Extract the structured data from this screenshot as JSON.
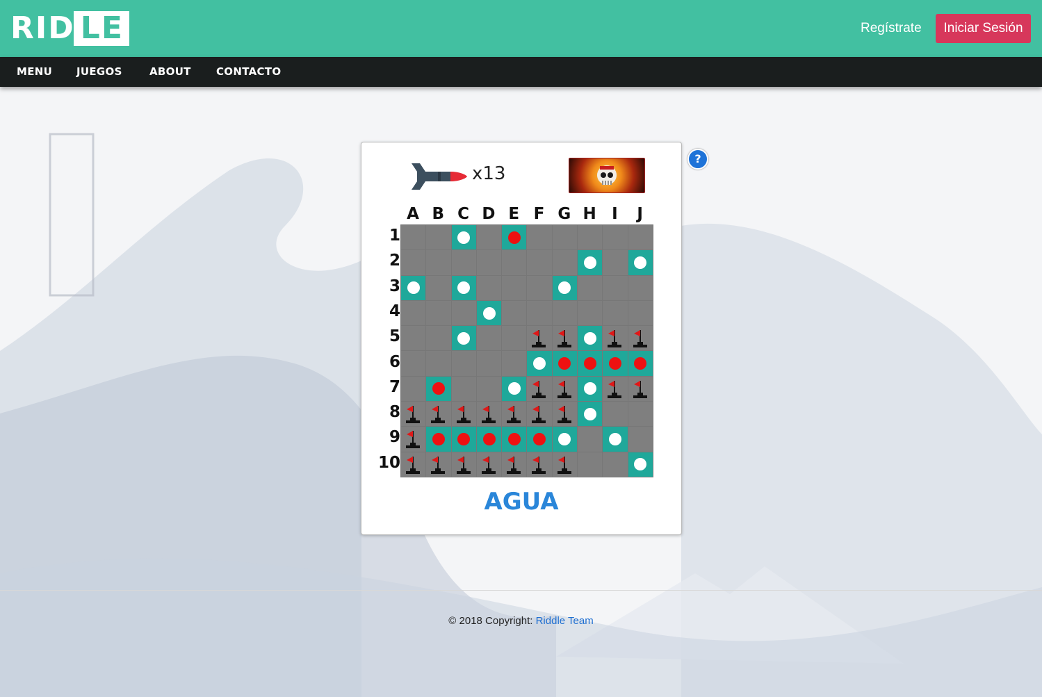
{
  "brand": {
    "logo_text": "RID",
    "logo_boxed_text": "LE"
  },
  "header": {
    "register_label": "Regístrate",
    "login_label": "Iniciar Sesión"
  },
  "nav": {
    "items": [
      "MENU",
      "JUEGOS",
      "ABOUT",
      "CONTACTO"
    ]
  },
  "game": {
    "ammo_label": "x13",
    "ammo_icon": "missile-icon",
    "enemy_icon": "skull-pilot-icon",
    "columns": [
      "A",
      "B",
      "C",
      "D",
      "E",
      "F",
      "G",
      "H",
      "I",
      "J"
    ],
    "rows": [
      "1",
      "2",
      "3",
      "4",
      "5",
      "6",
      "7",
      "8",
      "9",
      "10"
    ],
    "legend": {
      "W": "miss (white peg)",
      "R": "hit (red peg)",
      "S": "ship (flag)",
      ".": "unrevealed"
    },
    "board": [
      "..W.R.....",
      ".......W.W",
      "W.W...W...",
      "...W......",
      "..W..SSWSS",
      ".....WRRRR",
      ".R..WSSWSS",
      "SSSSSSSW..",
      "SRRRRRW.W.",
      "SSSSSSS..W"
    ],
    "status_text": "AGUA",
    "help_label": "?"
  },
  "footer": {
    "copyright": "© 2018 Copyright:",
    "team_link": "Riddle Team"
  },
  "colors": {
    "header": "#42c0a1",
    "nav": "#1a1e1e",
    "login": "#d7375b",
    "teal": "#1fa89a",
    "grid": "#7f7f7f",
    "status": "#2a86d9"
  }
}
